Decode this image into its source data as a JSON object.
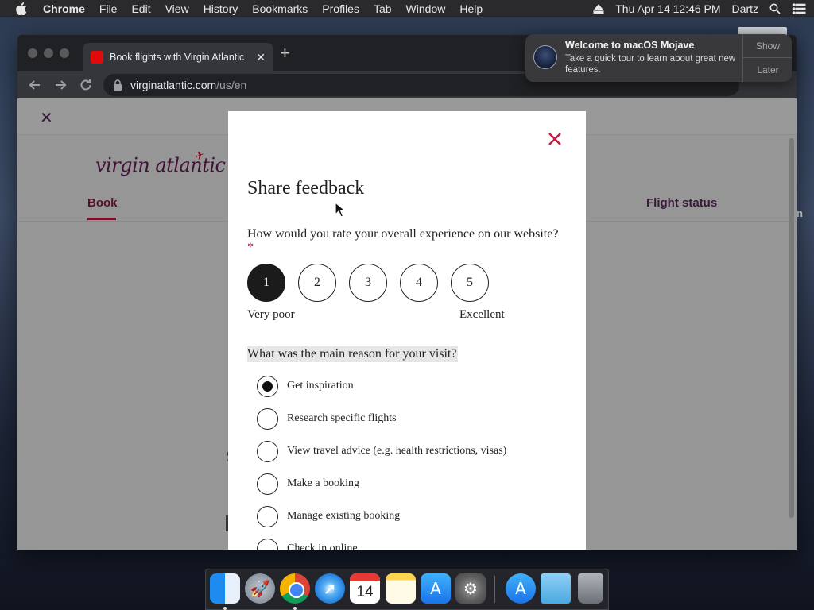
{
  "menubar": {
    "items": [
      "Chrome",
      "File",
      "Edit",
      "View",
      "History",
      "Bookmarks",
      "Profiles",
      "Tab",
      "Window",
      "Help"
    ],
    "datetime": "Thu Apr 14  12:46 PM",
    "user": "Dartz"
  },
  "browser": {
    "tab_title": "Book flights with Virgin Atlantic",
    "url_host": "virginatlantic.com",
    "url_path": "/us/en"
  },
  "page": {
    "logo_text": "virgin atlantic",
    "nav_book": "Book",
    "nav_flight_status": "Flight status",
    "desktop_partial": "n"
  },
  "modal": {
    "title": "Share feedback",
    "question1": "How would you rate your overall experience on our website?",
    "required_mark": "*",
    "ratings": [
      "1",
      "2",
      "3",
      "4",
      "5"
    ],
    "selected_rating": "1",
    "scale_low": "Very poor",
    "scale_high": "Excellent",
    "question2": "What was the main reason for your visit?",
    "options": [
      "Get inspiration",
      "Research specific flights",
      "View travel advice (e.g. health restrictions, visas)",
      "Make a booking",
      "Manage existing booking",
      "Check in online"
    ],
    "selected_option": "Get inspiration"
  },
  "notification": {
    "title": "Welcome to macOS Mojave",
    "body": "Take a quick tour to learn about great new features.",
    "show_label": "Show",
    "later_label": "Later"
  },
  "dock": {
    "calendar_day": "14",
    "items": [
      "finder",
      "launchpad",
      "chrome",
      "safari",
      "calendar",
      "notes",
      "app-store",
      "system-preferences",
      "app-store",
      "downloads-folder",
      "trash"
    ]
  },
  "colors": {
    "accent": "#c81a3e",
    "brand_purple": "#6e1d5d",
    "selected_rating_bg": "#1b1b1b"
  }
}
